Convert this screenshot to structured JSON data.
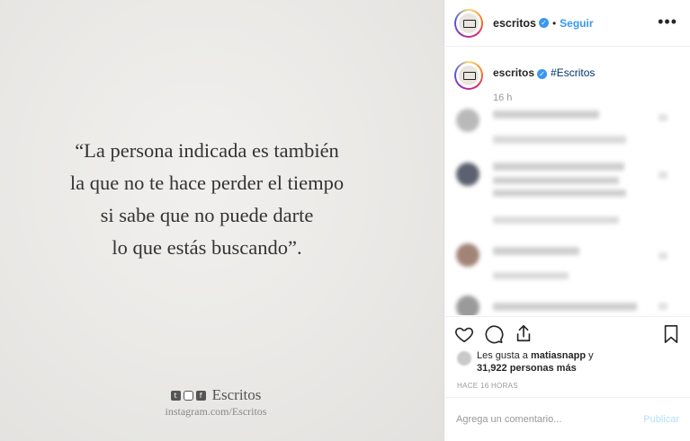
{
  "post": {
    "quote": "“La persona indicada es también\nla que no te hace perder el tiempo\nsi sabe que no puede darte\nlo que estás buscando”.",
    "brand_name": "Escritos",
    "brand_url": "instagram.com/Escritos",
    "brand_icons": [
      "twitter-icon",
      "instagram-icon",
      "facebook-icon"
    ]
  },
  "header": {
    "username": "escritos",
    "separator": "•",
    "follow_label": "Seguir",
    "more_label": "•••"
  },
  "caption": {
    "username": "escritos",
    "text": "#Escritos",
    "time": "16 h"
  },
  "likes": {
    "prefix": "Les gusta a",
    "user": "matiasnapp",
    "conj": "y",
    "count_text": "31,922 personas más"
  },
  "time_ago": "HACE 16 HORAS",
  "comment": {
    "placeholder": "Agrega un comentario...",
    "publish_label": "Publicar"
  },
  "colors": {
    "accent": "#3897f0",
    "hashtag": "#003569",
    "publish_disabled": "#b2dffc"
  }
}
